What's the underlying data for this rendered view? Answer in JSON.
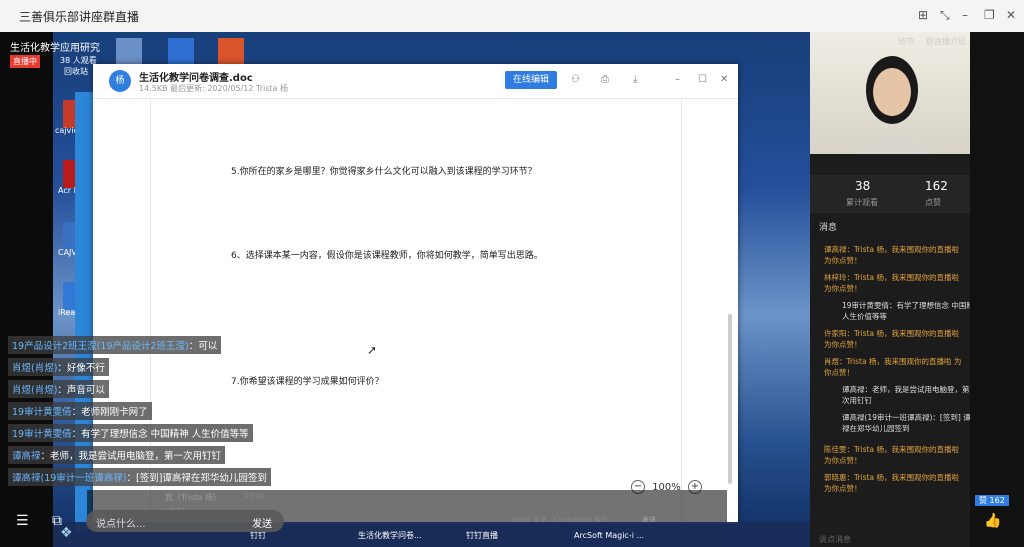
{
  "window": {
    "title": "三善俱乐部讲座群直播",
    "controls": [
      "⊞",
      "⤡",
      "–",
      "❐",
      "✕"
    ]
  },
  "stream": {
    "title": "生活化教学应用研究",
    "live_badge": "直播中",
    "viewers": "38 人观看"
  },
  "desktop_icons": [
    {
      "label": "回收站"
    },
    {
      "label": "cajvie"
    },
    {
      "label": "Acr Reac"
    },
    {
      "label": "CAJV"
    },
    {
      "label": "iRea"
    }
  ],
  "document": {
    "avatar": "杨",
    "filename": "生活化教学问卷调查.doc",
    "meta": "14.5KB  最后更新: 2020/05/12 Trista  杨",
    "edit_button": "在线编辑",
    "questions": [
      "5.你所在的家乡是哪里？你觉得家乡什么文化可以融入到该课程的学习环节？",
      "6、选择课本某一内容，假设你是该课程教师，你将如何教学，简单写出思路。",
      "7.你希望该课程的学习成果如何评价？"
    ],
    "zoom_level": "100%",
    "zoom_minus": "−",
    "zoom_plus": "+",
    "under_doc": {
      "sender": "我（Trista 杨）",
      "sender_date": "05-18",
      "file_label": "[文件]",
      "hint": "Enter 发送，Ctrl+Enter 换行",
      "send": "发送"
    }
  },
  "chat_overlay": [
    {
      "user": "19产品设计2班王滢(19产品设计2班王滢)",
      "text": "：可以"
    },
    {
      "user": "肖煜(肖煜)",
      "text": "：好像不行"
    },
    {
      "user": "肖煜(肖煜)",
      "text": "：声音可以"
    },
    {
      "user": "19审计黄雯倩",
      "text": "：老师刚刚卡网了"
    },
    {
      "user": "19审计黄雯倩",
      "text": "：有学了理想信念 中国精神 人生价值等等"
    },
    {
      "user": "谭高禄",
      "text": "：老师，我是尝试用电脑登，第一次用钉钉"
    },
    {
      "user": "谭高禄(19审计一班谭高禄)",
      "text": "：[签到]谭高禄在郑华幼儿园签到"
    }
  ],
  "input_bar": {
    "placeholder": "说点什么...",
    "send": "发送"
  },
  "taskbar": {
    "items": [
      "钉钉",
      "生活化教学问卷...",
      "钉钉直播",
      "ArcSoft Magic-i ..."
    ]
  },
  "side_panel": {
    "top_links": [
      "结中",
      "群直播介绍",
      "举报"
    ],
    "stats": [
      {
        "value": "38",
        "label": "累计观看"
      },
      {
        "value": "162",
        "label": "点赞"
      }
    ],
    "messages_title": "消息",
    "messages": [
      {
        "style": "gold",
        "text": "谭高禄：Trista 杨，我来围观你的直播啦 为你点赞！"
      },
      {
        "style": "gold",
        "text": "林梓玲：Trista 杨，我来围观你的直播啦 为你点赞！"
      },
      {
        "style": "white",
        "text": "19审计黄雯倩：有学了理想信念 中国精神 人生价值等等"
      },
      {
        "style": "gold",
        "text": "许家阳：Trista 杨，我来围观你的直播啦 为你点赞！"
      },
      {
        "style": "gold",
        "text": "肖煜：Trista 杨，我来围观你的直播啦 为你点赞！"
      },
      {
        "style": "white",
        "text": "谭高禄：老师，我是尝试用电脑登，第一次用钉钉"
      },
      {
        "style": "white",
        "text": "谭高禄(19审计一班谭高禄)：[签到] 谭高禄在郑华幼儿园签到"
      },
      {
        "style": "gold",
        "text": "陈佳雯：Trista 杨，我来围观你的直播啦 为你点赞！"
      },
      {
        "style": "gold",
        "text": "郭晓惠：Trista 杨，我来围观你的直播啦 为你点赞！"
      }
    ],
    "input_placeholder": "说点消息",
    "likes_badge": "赞 162"
  }
}
